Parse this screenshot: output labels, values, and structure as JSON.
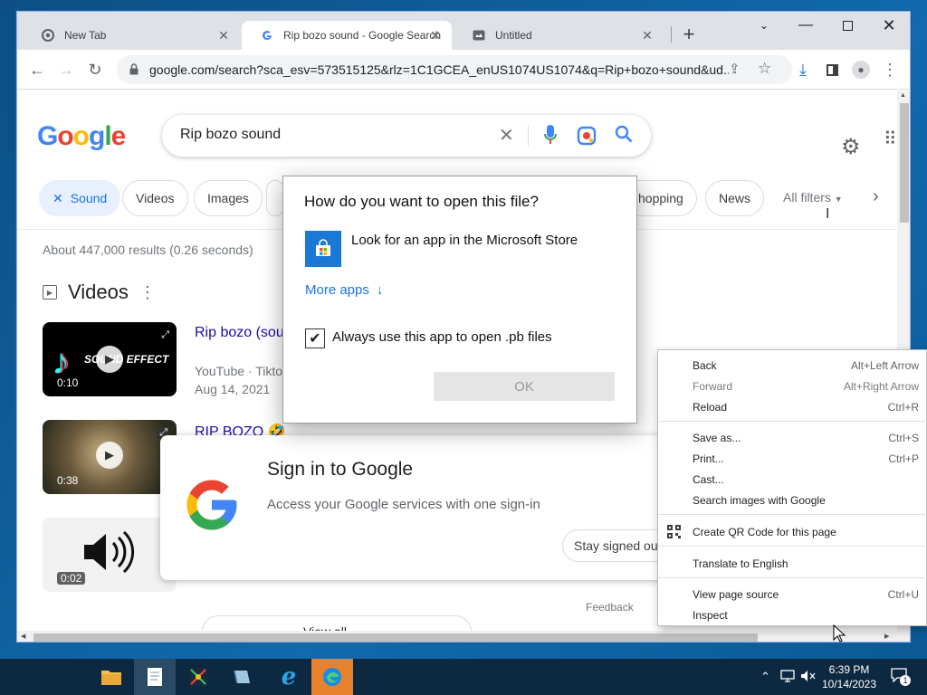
{
  "tabs": [
    {
      "title": "New Tab",
      "icon": "chrome-icon"
    },
    {
      "title": "Rip bozo sound - Google Search",
      "icon": "google-g-icon"
    },
    {
      "title": "Untitled",
      "icon": "media-icon"
    }
  ],
  "address_bar": {
    "url": "google.com/search?sca_esv=573515125&rlz=1C1GCEA_enUS1074US1074&q=Rip+bozo+sound&ud..."
  },
  "google": {
    "logo": "Google",
    "query": "Rip bozo sound",
    "chips": [
      "Sound",
      "Videos",
      "Images",
      "hopping",
      "News"
    ],
    "all_filters": "All filters",
    "stats": "About 447,000 results (0.26 seconds)",
    "videos_heading": "Videos",
    "videos": [
      {
        "title": "Rip bozo (sou",
        "source": "YouTube · Tiktol",
        "date": "Aug 14, 2021",
        "duration": "0:10",
        "thumb_text": "SOUND EFFECT"
      },
      {
        "title": "RIP BOZO 🤣",
        "duration": "0:38"
      },
      {
        "duration": "0:02"
      }
    ],
    "feedback": "Feedback",
    "view_all": "View all"
  },
  "signin_card": {
    "title": "Sign in to Google",
    "subtitle": "Access your Google services with one sign-in",
    "stay_button": "Stay signed out"
  },
  "open_with_dialog": {
    "title": "How do you want to open this file?",
    "store_option": "Look for an app in the Microsoft Store",
    "more_apps": "More apps",
    "always_checkbox": "Always use this app to open .pb files",
    "always_checked": true,
    "ok_button": "OK"
  },
  "context_menu": {
    "items": [
      {
        "label": "Back",
        "shortcut": "Alt+Left Arrow",
        "disabled": false
      },
      {
        "label": "Forward",
        "shortcut": "Alt+Right Arrow",
        "disabled": true
      },
      {
        "label": "Reload",
        "shortcut": "Ctrl+R",
        "disabled": false
      },
      {
        "label": "Save as...",
        "shortcut": "Ctrl+S",
        "disabled": false
      },
      {
        "label": "Print...",
        "shortcut": "Ctrl+P",
        "disabled": false
      },
      {
        "label": "Cast...",
        "shortcut": "",
        "disabled": false
      },
      {
        "label": "Search images with Google",
        "shortcut": "",
        "disabled": false
      },
      {
        "label": "Create QR Code for this page",
        "shortcut": "",
        "disabled": false
      },
      {
        "label": "Translate to English",
        "shortcut": "",
        "disabled": false
      },
      {
        "label": "View page source",
        "shortcut": "Ctrl+U",
        "disabled": false
      },
      {
        "label": "Inspect",
        "shortcut": "",
        "disabled": false
      }
    ]
  },
  "taskbar": {
    "time": "6:39 PM",
    "date": "10/14/2023",
    "notification_count": "1",
    "apps": [
      "file-explorer-icon",
      "notepad-icon",
      "paint-icon",
      "app-icon",
      "ie-icon",
      "edge-icon"
    ]
  },
  "colors": {
    "accent": "#1a73e8",
    "taskbar": "#0d2841",
    "link": "#1a0dab"
  }
}
